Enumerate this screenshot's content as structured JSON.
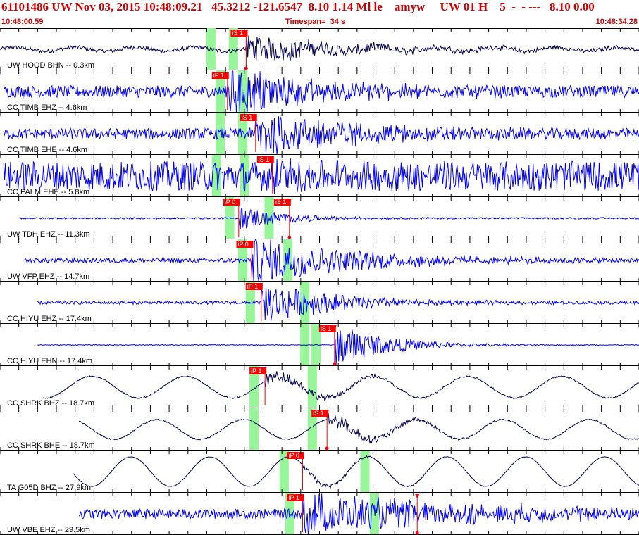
{
  "header": {
    "title": "61101486 UW Nov 03, 2015 10:48:09.21   45.3212 -121.6547  8.10 1.14 Ml le    amyw     UW 01 H    5  -  - ---   8.10 0.00",
    "start_time": "10:48:00.59",
    "timespan": "Timespan=  34 s",
    "end_time": "10:48:34.28"
  },
  "colors": {
    "trace_blue": "#0000ff",
    "trace_navy": "#000055",
    "pick_red": "#ff0000",
    "window_green": "#99f599",
    "header_red": "#cc0000"
  },
  "chart_data": {
    "type": "seismogram",
    "x_range_s": [
      0,
      34
    ],
    "traces": [
      {
        "label": "UW HOOD BHN -- 0.3km",
        "color": "navy",
        "style": "hf",
        "start": 0.0,
        "end": 34.2,
        "noise": 0.1,
        "onset": 13.1,
        "peak": 0.5,
        "decay": 0.18,
        "lp": 0.1,
        "picks": [
          {
            "label": "iS 1",
            "t": 13.1,
            "flag": true
          }
        ],
        "windows": [
          11.2,
          12.4
        ]
      },
      {
        "label": "CC TIMB EHZ -- 4.6km",
        "color": "blue",
        "style": "hf",
        "start": 0.2,
        "end": 34.4,
        "noise": 0.3,
        "onset": 12.1,
        "peak": 0.95,
        "decay": 0.22,
        "lp": 0,
        "picks": [
          {
            "label": "iP 1",
            "t": 12.1,
            "flag": false
          }
        ],
        "windows": [
          11.7,
          12.9
        ]
      },
      {
        "label": "CC TIMB EHE -- 4.6km",
        "color": "blue",
        "style": "hf",
        "start": 0.2,
        "end": 34.4,
        "noise": 0.28,
        "onset": 13.6,
        "peak": 0.95,
        "decay": 0.2,
        "lp": 0,
        "picks": [
          {
            "label": "iS 1",
            "t": 13.6,
            "flag": false
          }
        ],
        "windows": [
          11.7,
          12.9
        ]
      },
      {
        "label": "CC PALM EHE -- 5.8km",
        "color": "blue",
        "style": "hf",
        "start": 0.2,
        "end": 34.4,
        "noise": 0.75,
        "onset": 14.5,
        "peak": 0.3,
        "decay": 0.3,
        "lp": 0,
        "picks": [
          {
            "label": "iS 1",
            "t": 14.5,
            "flag": false
          }
        ],
        "windows": [
          11.5,
          13.0
        ]
      },
      {
        "label": "UW TDH EHZ -- 11.3km",
        "color": "blue",
        "style": "hf",
        "start": 1.0,
        "end": 35.3,
        "noise": 0.04,
        "onset": 12.7,
        "peak": 0.45,
        "decay": 0.4,
        "lp": 0,
        "picks": [
          {
            "label": "iP 0",
            "t": 12.7,
            "flag": false
          },
          {
            "label": "iS 1",
            "t": 15.4,
            "flag": true
          }
        ],
        "windows": [
          12.2,
          14.3
        ]
      },
      {
        "label": "UW VFP EHZ -- 14.7km",
        "color": "blue",
        "style": "hf",
        "start": 1.3,
        "end": 35.9,
        "noise": 0.12,
        "onset": 13.4,
        "peak": 0.9,
        "decay": 0.18,
        "lp": 0,
        "picks": [
          {
            "label": "iP 0",
            "t": 13.4,
            "flag": false
          }
        ],
        "windows": [
          12.9,
          15.3
        ]
      },
      {
        "label": "CC HIYU EHZ -- 17.4km",
        "color": "blue",
        "style": "hf",
        "start": 2.0,
        "end": 36.3,
        "noise": 0.08,
        "onset": 13.9,
        "peak": 0.8,
        "decay": 0.25,
        "lp": 0,
        "picks": [
          {
            "label": "iP 1",
            "t": 13.9,
            "flag": false
          }
        ],
        "windows": [
          13.3,
          16.2
        ]
      },
      {
        "label": "CC HIYU EHN -- 17.4km",
        "color": "blue",
        "style": "hf",
        "start": 2.0,
        "end": 36.3,
        "noise": 0.02,
        "onset": 17.8,
        "peak": 0.8,
        "decay": 0.35,
        "lp": 0,
        "picks": [
          {
            "label": "iS 1",
            "t": 17.8,
            "flag": true
          }
        ],
        "windows": [
          16.2,
          16.8
        ]
      },
      {
        "label": "CC SHRK BHZ -- 18.7km",
        "color": "navy",
        "style": "lp",
        "start": 2.3,
        "end": 36.6,
        "noise": 0.03,
        "onset": 14.1,
        "peak": 0.25,
        "decay": 0.25,
        "lp": 0.5,
        "lpAmp": 0.55,
        "lpPeriod": 5.0,
        "picks": [
          {
            "label": "iP 1",
            "t": 14.1,
            "flag": false
          }
        ],
        "windows": [
          13.5,
          16.6
        ]
      },
      {
        "label": "CC SHRK BHE -- 18.7km",
        "color": "navy",
        "style": "lp",
        "start": 4.2,
        "end": 36.6,
        "noise": 0.03,
        "onset": 17.4,
        "peak": 0.3,
        "decay": 0.3,
        "lp": 0.5,
        "lpAmp": 0.5,
        "lpPeriod": 4.6,
        "picks": [
          {
            "label": "iS 1",
            "t": 17.4,
            "flag": true
          }
        ],
        "windows": [
          13.5,
          16.6
        ]
      },
      {
        "label": "TA G05D BHZ -- 27.9km",
        "color": "navy",
        "style": "lp",
        "start": 3.9,
        "end": 36.6,
        "noise": 0.01,
        "onset": 16.1,
        "peak": 0.1,
        "decay": 0.3,
        "lp": 0.5,
        "lpAmp": 0.75,
        "lpPeriod": 4.2,
        "picks": [
          {
            "label": "iP 0",
            "t": 16.1,
            "flag": false
          }
        ],
        "windows": [
          15.1,
          19.4
        ]
      },
      {
        "label": "UW VBE EHZ -- 29.5km",
        "color": "blue",
        "style": "hf",
        "start": 4.2,
        "end": 36.6,
        "noise": 0.25,
        "onset": 16.1,
        "peak": 0.7,
        "decay": 0.1,
        "lp": 0,
        "picks": [
          {
            "label": "iP 1",
            "t": 16.1,
            "flag": false
          },
          {
            "label": "",
            "t": 22.2,
            "flag": true
          }
        ],
        "windows": [
          15.4,
          19.9
        ]
      }
    ]
  }
}
